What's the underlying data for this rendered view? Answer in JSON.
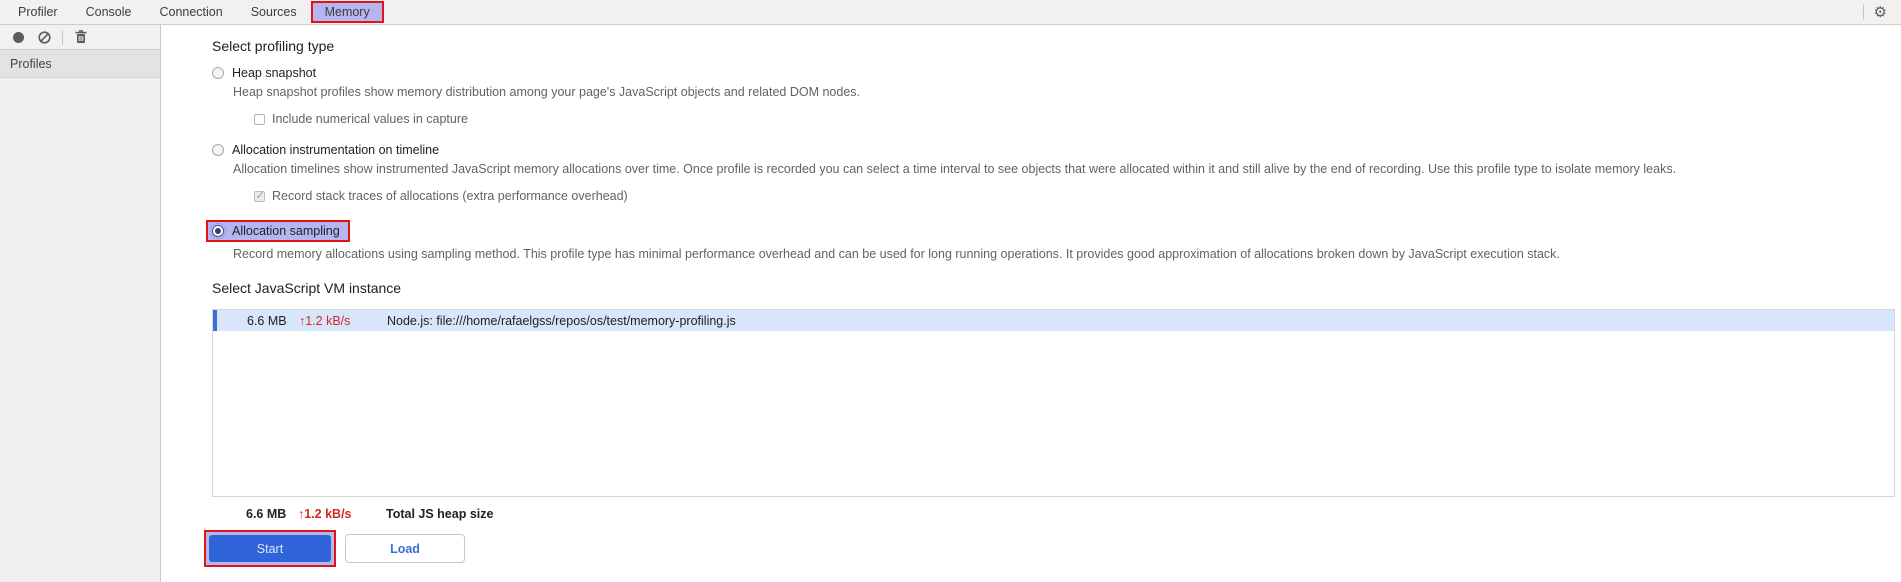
{
  "tabs": {
    "items": [
      {
        "label": "Profiler",
        "active": false
      },
      {
        "label": "Console",
        "active": false
      },
      {
        "label": "Connection",
        "active": false
      },
      {
        "label": "Sources",
        "active": false
      },
      {
        "label": "Memory",
        "active": true
      }
    ]
  },
  "toolbar": {
    "icons": [
      "record-icon",
      "clear-icon",
      "delete-icon"
    ],
    "settings_icon": "gear-icon"
  },
  "sidebar": {
    "items": [
      {
        "label": "Profiles",
        "selected": true
      }
    ]
  },
  "profiling": {
    "heading": "Select profiling type",
    "options": [
      {
        "label": "Heap snapshot",
        "selected": false,
        "desc": "Heap snapshot profiles show memory distribution among your page's JavaScript objects and related DOM nodes.",
        "sub_checkbox": {
          "label": "Include numerical values in capture",
          "checked": false,
          "disabled": false
        }
      },
      {
        "label": "Allocation instrumentation on timeline",
        "selected": false,
        "desc": "Allocation timelines show instrumented JavaScript memory allocations over time. Once profile is recorded you can select a time interval to see objects that were allocated within it and still alive by the end of recording. Use this profile type to isolate memory leaks.",
        "sub_checkbox": {
          "label": "Record stack traces of allocations (extra performance overhead)",
          "checked": true,
          "disabled": true
        }
      },
      {
        "label": "Allocation sampling",
        "selected": true,
        "highlighted": true,
        "desc": "Record memory allocations using sampling method. This profile type has minimal performance overhead and can be used for long running operations. It provides good approximation of allocations broken down by JavaScript execution stack."
      }
    ]
  },
  "vm": {
    "heading": "Select JavaScript VM instance",
    "instances": [
      {
        "size": "6.6 MB",
        "rate": "↑1.2 kB/s",
        "name": "Node.js: file:///home/rafaelgss/repos/os/test/memory-profiling.js",
        "selected": true
      }
    ],
    "total": {
      "size": "6.6 MB",
      "rate": "↑1.2 kB/s",
      "label": "Total JS heap size"
    }
  },
  "actions": {
    "start": "Start",
    "load": "Load"
  },
  "colors": {
    "annotation_red": "#e01414",
    "annotation_lavender": "#b5b6ef",
    "selected_row_bg": "#d8e6fb",
    "selected_row_stripe": "#3e6ed8",
    "rate_red": "#d32a22",
    "primary_button_blue": "#3065d9",
    "toolbar_bg": "#f2f1f0"
  }
}
